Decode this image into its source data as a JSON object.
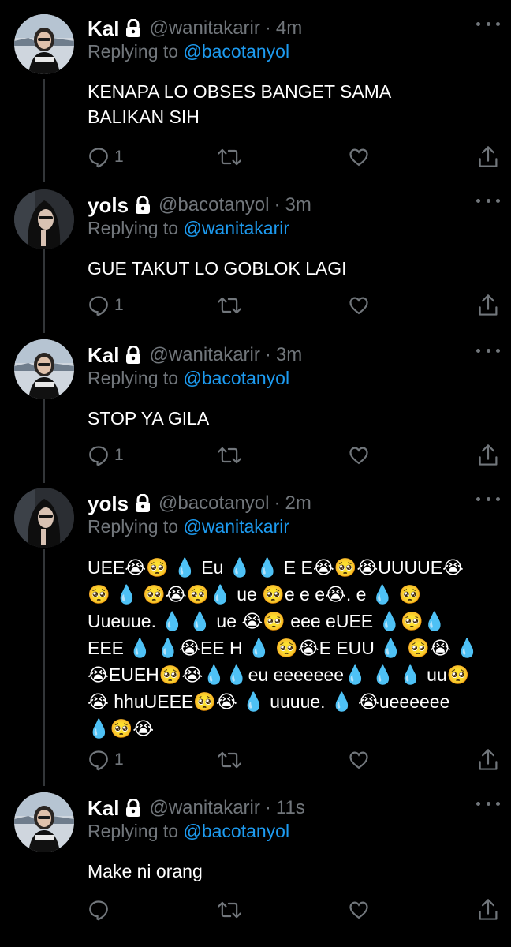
{
  "tweets": [
    {
      "name": "Kal",
      "handle": "@wanitakarir",
      "time": "4m",
      "replying_label": "Replying to",
      "replying_to": "@bacotanyol",
      "text": "KENAPA LO OBSES BANGET SAMA\nBALIKAN SIH",
      "reply_count": "1",
      "avatar": "avatar-kal"
    },
    {
      "name": "yols",
      "handle": "@bacotanyol",
      "time": "3m",
      "replying_label": "Replying to",
      "replying_to": "@wanitakarir",
      "text": "GUE TAKUT LO GOBLOK LAGI",
      "reply_count": "1",
      "avatar": "avatar-yols"
    },
    {
      "name": "Kal",
      "handle": "@wanitakarir",
      "time": "3m",
      "replying_label": "Replying to",
      "replying_to": "@bacotanyol",
      "text": "STOP YA GILA",
      "reply_count": "1",
      "avatar": "avatar-kal"
    },
    {
      "name": "yols",
      "handle": "@bacotanyol",
      "time": "2m",
      "replying_label": "Replying to",
      "replying_to": "@wanitakarir",
      "text": "UEE😭🥺 💧 Eu 💧 💧 E E😭🥺😭UUUUE😭\n🥺 💧 🥺😭🥺💧 ue 🥺e e e😭. e 💧 🥺\nUueuue. 💧 💧 ue 😭🥺 eee eUEE 💧🥺💧\nEEE 💧 💧😭EE H 💧 🥺😭E EUU 💧 🥺😭 💧\n😭EUEH🥺😭💧💧eu eeeeeee💧 💧 💧 uu🥺\n😭 hhuUEEE🥺😭 💧 uuuue. 💧 😭ueeeeee\n💧🥺😭",
      "reply_count": "1",
      "avatar": "avatar-yols"
    },
    {
      "name": "Kal",
      "handle": "@wanitakarir",
      "time": "11s",
      "replying_label": "Replying to",
      "replying_to": "@bacotanyol",
      "text": "Make ni orang",
      "reply_count": "",
      "avatar": "avatar-kal"
    }
  ],
  "icons": {
    "reply": "reply-icon",
    "retweet": "retweet-icon",
    "like": "heart-icon",
    "share": "share-icon",
    "lock": "lock-icon",
    "more": "more-icon"
  },
  "colors": {
    "background": "#000000",
    "text": "#ffffff",
    "secondary": "#71767b",
    "link": "#1d9bf0",
    "thread_line": "#333639"
  }
}
